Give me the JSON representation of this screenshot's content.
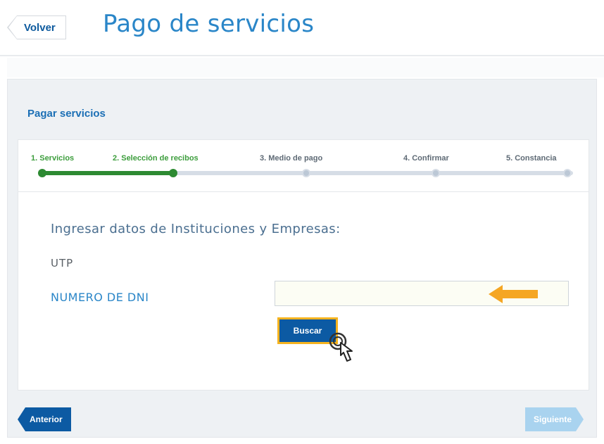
{
  "header": {
    "back_label": "Volver",
    "title": "Pago de servicios"
  },
  "panel": {
    "section_title": "Pagar servicios"
  },
  "stepper": {
    "steps": [
      {
        "label": "1. Servicios",
        "state": "done"
      },
      {
        "label": "2. Selección de recibos",
        "state": "done"
      },
      {
        "label": "3. Medio de pago",
        "state": "todo"
      },
      {
        "label": "4. Confirmar",
        "state": "todo"
      },
      {
        "label": "5. Constancia",
        "state": "todo"
      }
    ],
    "completed_steps": 2
  },
  "form": {
    "heading": "Ingresar datos de Instituciones y Empresas:",
    "institution": "UTP",
    "dni_label": "NUMERO DE DNI",
    "dni_value": "",
    "search_label": "Buscar"
  },
  "nav": {
    "prev_label": "Anterior",
    "next_label": "Siguiente"
  },
  "colors": {
    "accent_blue": "#2a86c8",
    "button_blue": "#0c5aa3",
    "progress_green": "#2d8a32",
    "highlight_orange": "#f5a623"
  },
  "icons": [
    "chevron-left-icon",
    "arrow-left-icon",
    "hand-cursor-icon"
  ]
}
